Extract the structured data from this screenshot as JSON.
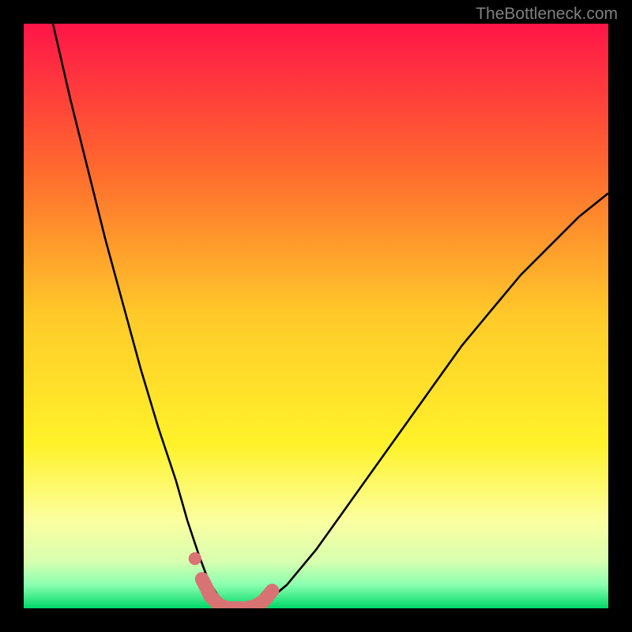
{
  "watermark": "TheBottleneck.com",
  "chart_data": {
    "type": "line",
    "title": "",
    "xlabel": "",
    "ylabel": "",
    "xlim": [
      0,
      100
    ],
    "ylim": [
      0,
      100
    ],
    "gradient_colors": {
      "top": "#ff1a4a",
      "mid_upper": "#ff8a2a",
      "mid": "#ffe82a",
      "mid_lower": "#fbff6a",
      "bottom_upper": "#c8ff8a",
      "bottom": "#00e676"
    },
    "series": [
      {
        "name": "left-curve",
        "stroke": "#000000",
        "x": [
          5,
          8,
          11,
          14,
          17,
          20,
          23,
          26,
          28,
          30,
          31.5,
          33,
          34,
          35,
          36
        ],
        "y": [
          100,
          87,
          75,
          63,
          52,
          41,
          31,
          22,
          15,
          9,
          5,
          2.5,
          1.2,
          0.5,
          0
        ]
      },
      {
        "name": "right-curve",
        "stroke": "#000000",
        "x": [
          40,
          42,
          45,
          50,
          55,
          60,
          65,
          70,
          75,
          80,
          85,
          90,
          95,
          100
        ],
        "y": [
          0,
          1.5,
          4,
          10,
          17,
          24,
          31,
          38,
          45,
          51,
          57,
          62,
          67,
          71
        ]
      },
      {
        "name": "marker-band",
        "stroke": "#d97373",
        "x": [
          30.5,
          32,
          33.5,
          35,
          36.5,
          38,
          39.5,
          41,
          42.5
        ],
        "y": [
          5,
          2,
          0.5,
          0,
          0,
          0,
          0.3,
          1.2,
          3
        ]
      }
    ],
    "markers": [
      {
        "name": "left-dot",
        "x": 29.3,
        "y": 8.5,
        "color": "#d97373",
        "r": 1.1
      }
    ]
  }
}
